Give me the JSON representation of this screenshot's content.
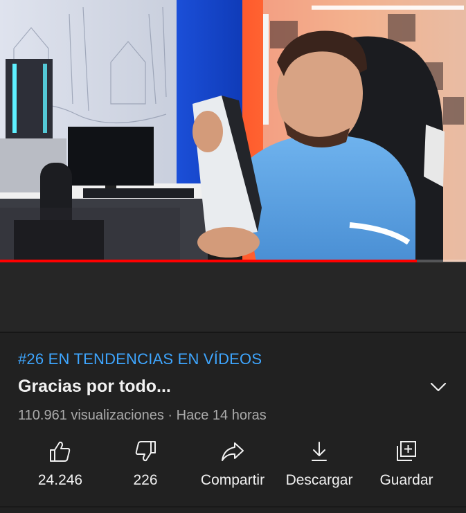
{
  "video": {
    "progress_fraction": 0.895,
    "progress_color": "#ff0000"
  },
  "info": {
    "trending_label": "#26 EN TENDENCIAS EN VÍDEOS",
    "title": "Gracias por todo...",
    "meta": "110.961 visualizaciones · Hace 14 horas"
  },
  "actions": {
    "like": {
      "label": "24.246",
      "icon": "thumbs-up-icon"
    },
    "dislike": {
      "label": "226",
      "icon": "thumbs-down-icon"
    },
    "share": {
      "label": "Compartir",
      "icon": "share-icon"
    },
    "download": {
      "label": "Descargar",
      "icon": "download-icon"
    },
    "save": {
      "label": "Guardar",
      "icon": "playlist-add-icon"
    }
  },
  "colors": {
    "background": "#212121",
    "accent_link": "#3ea6ff",
    "primary_text": "#f1f1f1",
    "secondary_text": "#aaaaaa"
  }
}
